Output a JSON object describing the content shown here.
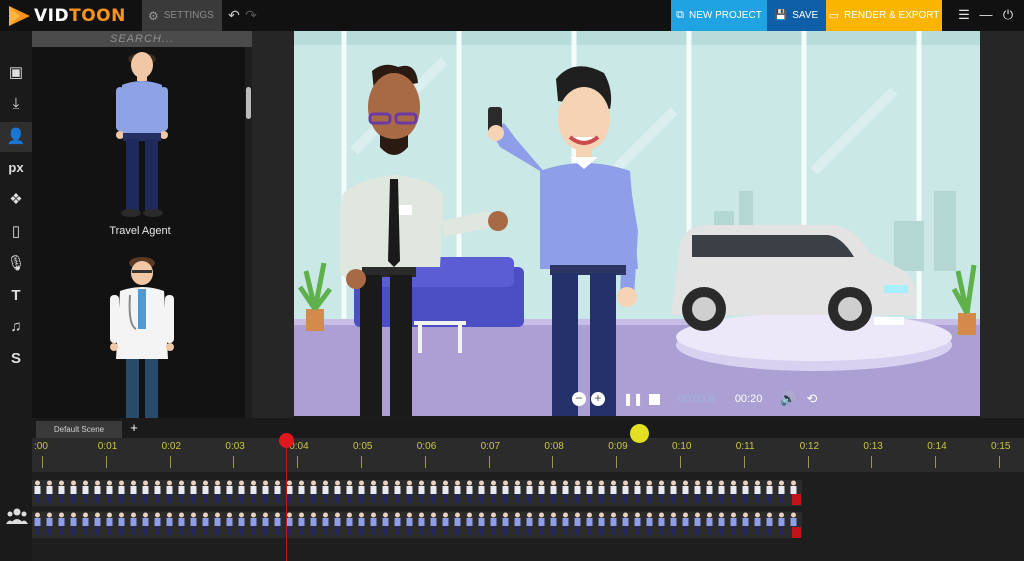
{
  "app": {
    "logo_part1": "VID",
    "logo_part2": "TOON",
    "settings_label": "SETTINGS",
    "new_project_label": "NEW PROJECT",
    "save_label": "SAVE",
    "render_label": "RENDER & EXPORT"
  },
  "library": {
    "search_placeholder": "SEARCH...",
    "characters": [
      {
        "label": "Travel Agent"
      },
      {
        "label": ""
      }
    ]
  },
  "rail": [
    "image-icon",
    "download-icon",
    "user-icon",
    "px-icon",
    "props-icon",
    "document-icon",
    "microphone-icon",
    "text-icon",
    "music-icon",
    "s-icon"
  ],
  "player": {
    "current_time": "00:03.8",
    "total_time": "00:20"
  },
  "timeline": {
    "scene_tab": "Default Scene",
    "ticks": [
      ":00",
      "0:01",
      "0:02",
      "0:03",
      "0:04",
      "0:05",
      "0:06",
      "0:07",
      "0:08",
      "0:09",
      "0:10",
      "0:11",
      "0:12",
      "0:13",
      "0:14",
      "0:15"
    ],
    "playhead_seconds": 3.9
  },
  "colors": {
    "accent_orange": "#f7931e",
    "new_project": "#1fa3e3",
    "save": "#0f5ea8",
    "render": "#f9b500",
    "playhead": "#e0171e",
    "tick_text": "#c9c54a"
  }
}
